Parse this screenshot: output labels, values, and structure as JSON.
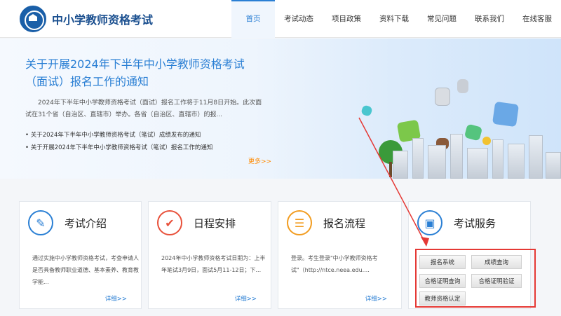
{
  "header": {
    "site_title": "中小学教师资格考试",
    "nav": [
      "首页",
      "考试动态",
      "项目政策",
      "资料下载",
      "常见问题",
      "联系我们",
      "在线客服"
    ]
  },
  "banner": {
    "title": "关于开展2024年下半年中小学教师资格考试（面试）报名工作的通知",
    "desc": "2024年下半年中小学教师资格考试（面试）报名工作将于11月8日开始。此次面试在31个省（自治区、直辖市）举办。各省（自治区、直辖市）的报...",
    "links": [
      "关于2024年下半年中小学教师资格考试（笔试）成绩发布的通知",
      "关于开展2024年下半年中小学教师资格考试（笔试）报名工作的通知"
    ],
    "more": "更多>>"
  },
  "cards": [
    {
      "title": "考试介绍",
      "text": "通过实施中小学教师资格考试，考查申请人是否具备教师职业道德、基本素养、教育教学能...",
      "more": "详细>>"
    },
    {
      "title": "日程安排",
      "text": "2024年中小学教师资格考试日期为：上半年笔试3月9日，面试5月11-12日；下...",
      "more": "详细>>"
    },
    {
      "title": "报名流程",
      "text": "登录。考生登录\"中小学教师资格考试\"（http://ntce.neea.edu....",
      "more": "详细>>"
    },
    {
      "title": "考试服务"
    }
  ],
  "services": [
    "报名系统",
    "成绩查询",
    "合格证明查询",
    "合格证明验证",
    "教师资格认定"
  ],
  "colors": {
    "accent": "#2a7fd4",
    "highlight": "#e53935",
    "more": "#ff8a00"
  }
}
